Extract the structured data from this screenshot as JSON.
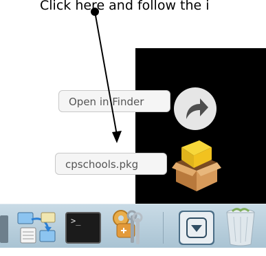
{
  "instruction": {
    "text": "Click here and follow the i"
  },
  "finder_popover": {
    "open_label": "Open in Finder",
    "file_label": "cpschools.pkg"
  },
  "icons": {
    "share": "share-arrow-icon",
    "package": "package-box-icon",
    "migration": "migration-assistant-icon",
    "terminal": "terminal-icon",
    "keychain": "keychain-access-icon",
    "downloads": "downloads-stack-icon",
    "trash": "trash-icon"
  },
  "dock": {
    "terminal_prompt": ">_"
  },
  "colors": {
    "dock_background": "#b6cddb",
    "panel_background": "#000000",
    "package_yellow": "#f2c21f",
    "package_brown": "#c98a4a",
    "downloads_frame": "#4a6d86"
  }
}
